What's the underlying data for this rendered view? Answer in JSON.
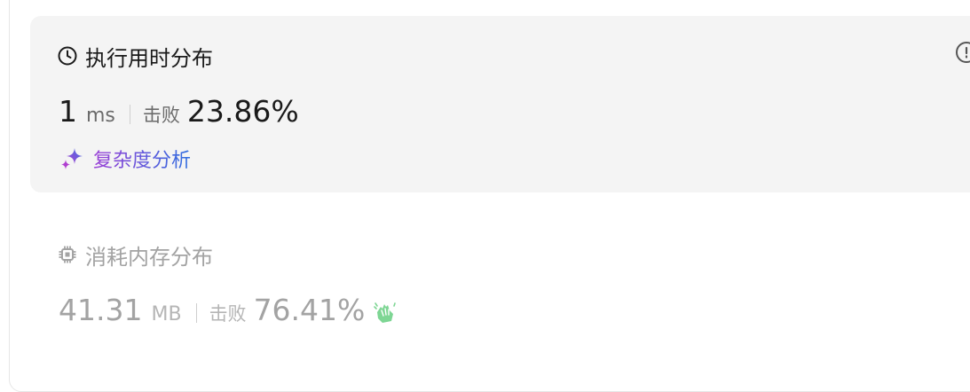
{
  "runtime": {
    "title": "执行用时分布",
    "value": "1",
    "unit": "ms",
    "beat_label": "击败",
    "beat_percent": "23.86%",
    "analysis_label": "复杂度分析"
  },
  "memory": {
    "title": "消耗内存分布",
    "value": "41.31",
    "unit": "MB",
    "beat_label": "击败",
    "beat_percent": "76.41%"
  },
  "icons": {
    "runtime": "clock-icon",
    "analysis": "sparkle-icon",
    "memory": "chip-icon",
    "info": "info-icon",
    "celebrate": "clapping-hands-icon"
  },
  "colors": {
    "analysis_gradient_start": "#9b3fd6",
    "analysis_gradient_end": "#2f6fe0",
    "clap_green": "#7ed694"
  }
}
